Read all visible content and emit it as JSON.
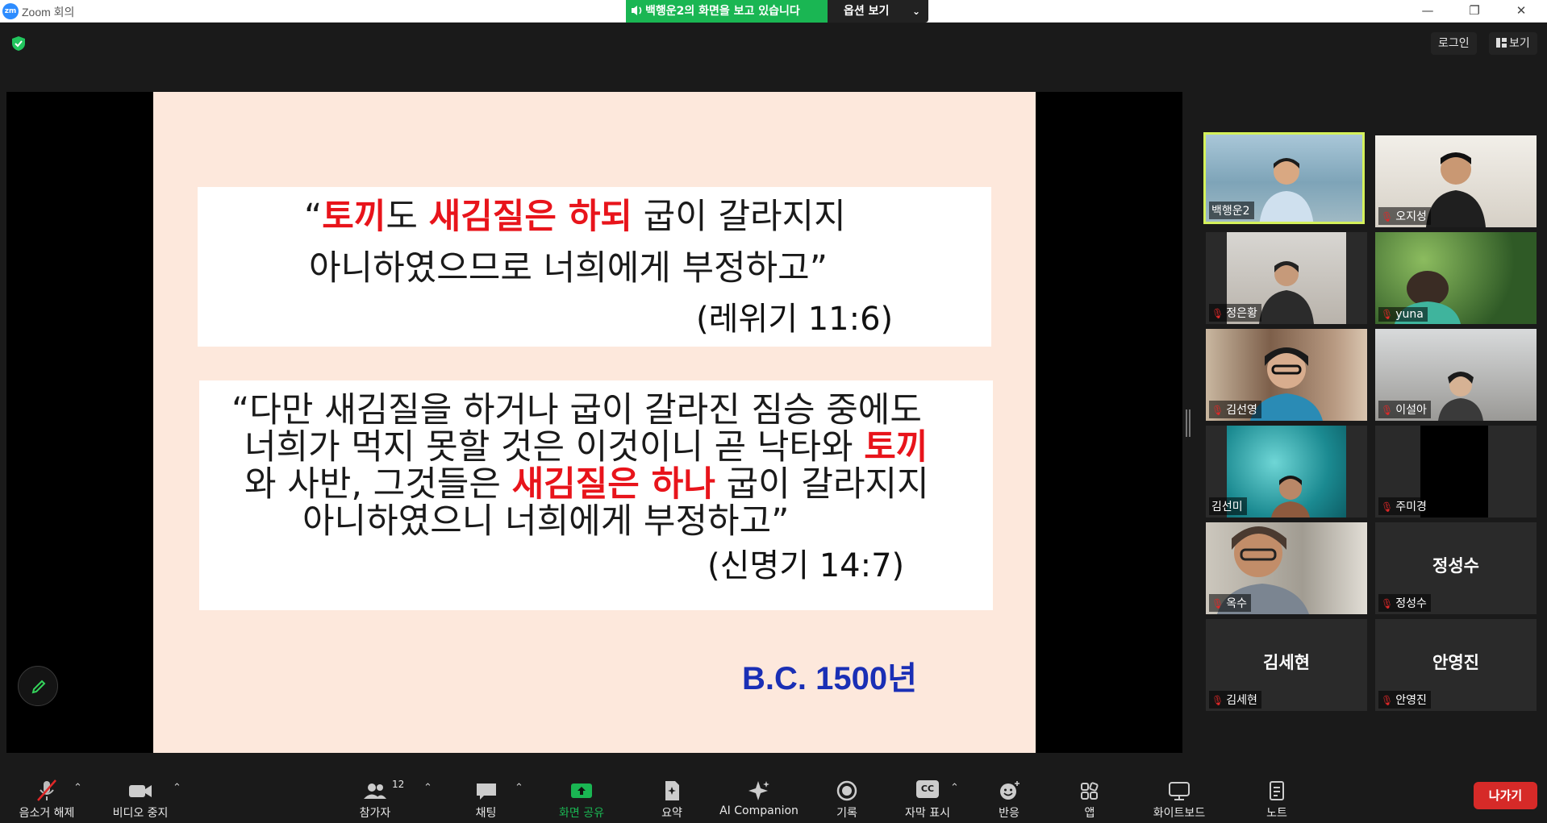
{
  "window": {
    "logo": "zm",
    "title": "Zoom 회의",
    "minimize_glyph": "—",
    "maximize_glyph": "❐",
    "close_glyph": "✕"
  },
  "share_banner": {
    "text": "백행운2의 화면을 보고 있습니다",
    "options_label": "옵션 보기",
    "options_chevron": "⌄"
  },
  "top_bar": {
    "login_label": "로그인",
    "view_label": "보기"
  },
  "slide": {
    "verse1": {
      "line1": [
        {
          "text": "“",
          "style": "normal"
        },
        {
          "text": "토끼",
          "style": "red"
        },
        {
          "text": "도 ",
          "style": "normal"
        },
        {
          "text": "새김질은 하되",
          "style": "red"
        },
        {
          "text": " 굽이 갈라지지",
          "style": "normal"
        }
      ],
      "line2": "아니하였으므로 너희에게 부정하고”",
      "reference": "(레위기 11:6)"
    },
    "verse2": {
      "line1": "“다만 새김질을 하거나 굽이 갈라진 짐승 중에도",
      "line2_prefix": "너희가 먹지 못할 것은 이것이니 곧 낙타와 ",
      "line2_red": "토끼",
      "line3_prefix": "와 사반, 그것들은 ",
      "line3_red": "새김질은 하나",
      "line3_suffix": " 굽이 갈라지지",
      "line4": "아니하였으니 너희에게 부정하고”",
      "reference": "(신명기 14:7)"
    },
    "date_label": "B.C. 1500년",
    "colors": {
      "background": "#fde8dc",
      "highlight": "#e8141b",
      "date": "#1a2fb5"
    }
  },
  "participants": [
    {
      "name": "백행운2",
      "muted": false,
      "video": true,
      "active_speaker": true
    },
    {
      "name": "오지성",
      "muted": true,
      "video": true
    },
    {
      "name": "정은황",
      "muted": true,
      "video": true
    },
    {
      "name": "yuna",
      "muted": true,
      "video": true
    },
    {
      "name": "김선영",
      "muted": true,
      "video": true
    },
    {
      "name": "이설아",
      "muted": true,
      "video": true
    },
    {
      "name": "김선미",
      "muted": false,
      "video": true
    },
    {
      "name": "주미경",
      "muted": true,
      "video": true
    },
    {
      "name": "옥수",
      "muted": true,
      "video": true
    },
    {
      "name": "정성수",
      "muted": true,
      "video": false,
      "display": "정성수"
    },
    {
      "name": "김세현",
      "muted": true,
      "video": false,
      "display": "김세현"
    },
    {
      "name": "안영진",
      "muted": true,
      "video": false,
      "display": "안영진"
    }
  ],
  "toolbar": {
    "mute_label": "음소거 해제",
    "video_label": "비디오 중지",
    "participants_label": "참가자",
    "participants_count": "12",
    "chat_label": "채팅",
    "share_label": "화면 공유",
    "summary_label": "요약",
    "ai_label": "AI Companion",
    "record_label": "기록",
    "captions_label": "자막 표시",
    "captions_icon_text": "CC",
    "reactions_label": "반응",
    "apps_label": "앱",
    "whiteboard_label": "화이트보드",
    "notes_label": "노트",
    "leave_label": "나가기",
    "caret": "⌃"
  }
}
